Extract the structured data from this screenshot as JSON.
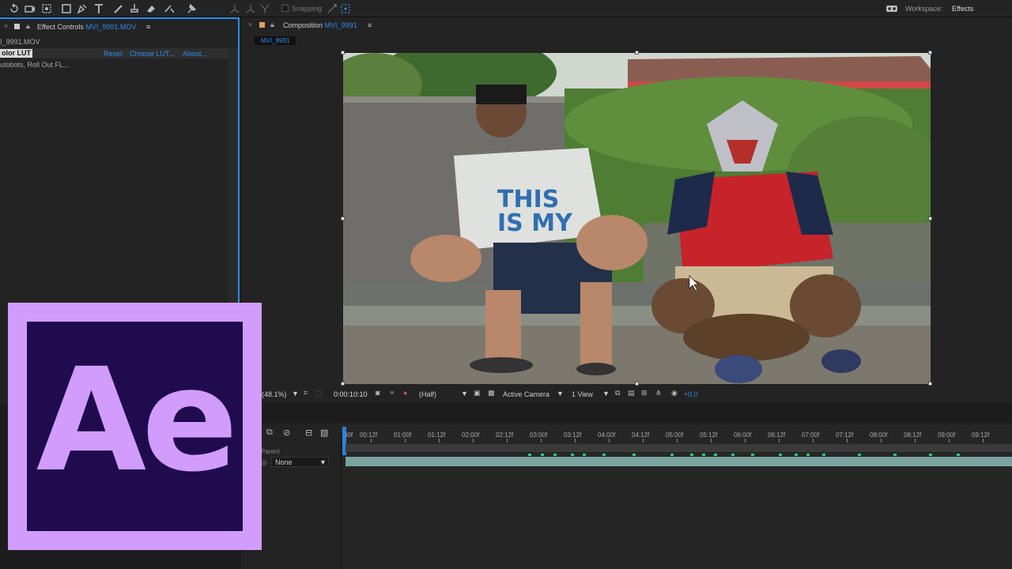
{
  "toolbar": {
    "snapping_label": "Snapping",
    "workspace_label": "Workspace:",
    "workspace_value": "Effects"
  },
  "effect_controls": {
    "tab_title": "Effect Controls",
    "tab_file": "MVI_9991.MOV",
    "layer_name": "I_9991.MOV",
    "effect_name": "olor LUT",
    "reset_label": "Reset",
    "choose_lut_label": "Choose LUT...",
    "about_label": "About...",
    "lut_value": "utobots, Roll Out FL..."
  },
  "composition": {
    "tab_title": "Composition",
    "tab_file": "MVI_9991",
    "subtab": "MVI_9991",
    "zoom": "(48.1%)",
    "timecode": "0:00:10:10",
    "resolution": "(Half)",
    "camera": "Active Camera",
    "views": "1 View",
    "exposure": "+0.0"
  },
  "timeline": {
    "parent_header": "Parent",
    "parent_value": "None",
    "ruler_labels": [
      "00f",
      "00:12f",
      "01:00f",
      "01:12f",
      "02:00f",
      "02:12f",
      "03:00f",
      "03:12f",
      "04:00f",
      "04:12f",
      "05:00f",
      "05:12f",
      "06:00f",
      "06:12f",
      "07:00f",
      "07:12f",
      "08:00f",
      "08:12f",
      "09:00f",
      "09:12f"
    ]
  },
  "logo": {
    "text": "Ae"
  },
  "colors": {
    "accent": "#2d8ceb",
    "logo_outer": "#d29cfd",
    "logo_inner": "#1f0b4d",
    "keyframe": "#2ecc71"
  }
}
